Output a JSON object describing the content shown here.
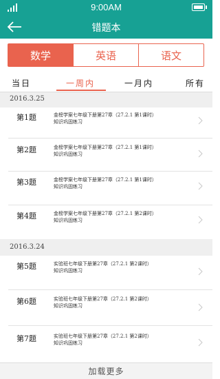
{
  "status": {
    "time": "9:00AM"
  },
  "appbar": {
    "title": "错题本"
  },
  "subjects": [
    {
      "label": "数学",
      "active": true
    },
    {
      "label": "英语",
      "active": false
    },
    {
      "label": "语文",
      "active": false
    }
  ],
  "filters": [
    {
      "label": "当日",
      "active": false
    },
    {
      "label": "一周内",
      "active": true
    },
    {
      "label": "一月内",
      "active": false
    },
    {
      "label": "所有",
      "active": false
    }
  ],
  "groups": [
    {
      "date": "2016.3.25",
      "items": [
        {
          "num": "第1题",
          "line1": "金榜学案七年级下册第27章（27.2.1 第1课时）",
          "line2": "知识巩固练习"
        },
        {
          "num": "第2题",
          "line1": "金榜学案七年级下册第27章（27.2.1 第1课时）",
          "line2": "知识巩固练习"
        },
        {
          "num": "第3题",
          "line1": "金榜学案七年级下册第27章（27.2.1 第1课时）",
          "line2": "知识巩固练习"
        },
        {
          "num": "第4题",
          "line1": "金榜学案七年级下册第27章（27.2.1 第2课时）",
          "line2": "知识巩固练习"
        }
      ]
    },
    {
      "date": "2016.3.24",
      "items": [
        {
          "num": "第5题",
          "line1": "实验班七年级下册第27章（27.2.1 第2课时）",
          "line2": "知识巩固练习"
        },
        {
          "num": "第6题",
          "line1": "实验班七年级下册第27章（27.2.1 第2课时）",
          "line2": "知识巩固练习"
        },
        {
          "num": "第7题",
          "line1": "实验班七年级下册第27章（27.2.1 第2课时）",
          "line2": "知识巩固练习"
        }
      ]
    }
  ],
  "footer": {
    "load_more": "加载更多"
  },
  "colors": {
    "primary": "#17a194",
    "accent": "#e9634e"
  }
}
